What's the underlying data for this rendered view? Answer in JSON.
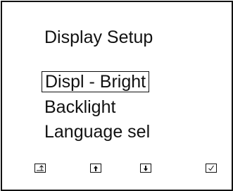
{
  "screen": {
    "title": "Display Setup",
    "menu_items": [
      {
        "label": "Displ - Bright",
        "selected": true
      },
      {
        "label": "Backlight",
        "selected": false
      },
      {
        "label": "Language sel",
        "selected": false
      }
    ]
  },
  "softkeys": [
    {
      "icon": "back-icon"
    },
    {
      "icon": "arrow-up-icon"
    },
    {
      "icon": "arrow-down-icon"
    },
    {
      "icon": "checkmark-icon"
    }
  ]
}
